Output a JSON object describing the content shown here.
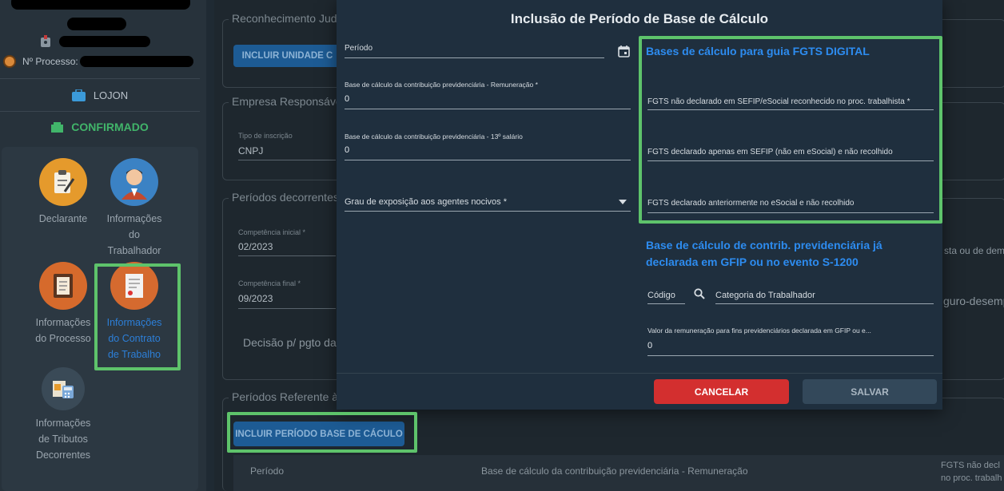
{
  "sidebar": {
    "process_label": "Nº Processo:",
    "user": "LOJON",
    "status": "CONFIRMADO",
    "menu": [
      {
        "label": "Declarante",
        "icon": "clipboard-pen-icon"
      },
      {
        "label": "Informações\ndo\nTrabalhador",
        "icon": "worker-avatar-icon"
      },
      {
        "label": "Informações\ndo Processo",
        "icon": "document-icon"
      },
      {
        "label": "Informações\ndo Contrato\nde Trabalho",
        "icon": "contract-icon"
      },
      {
        "label": "Informações\nde Tributos\nDecorrentes",
        "icon": "calculator-icon"
      }
    ]
  },
  "background": {
    "card1_title": "Reconhecimento Judi",
    "card1_button": "INCLUIR UNIDADE C",
    "card2_title": "Empresa Responsáve",
    "inscription_label": "Tipo de inscrição",
    "inscription_value": "CNPJ",
    "card3_title": "Períodos decorrentes",
    "comp_start_label": "Competência inicial *",
    "comp_start_value": "02/2023",
    "comp_end_label": "Competência final *",
    "comp_end_value": "09/2023",
    "decision_text": "Decisão p/ pgto da",
    "right_text1": "sta ou de dema",
    "right_text2": "guro-desemp",
    "card4_title": "Períodos Referente às",
    "include_period_button": "INCLUIR PERÍODO BASE DE CÁCULO",
    "table_headers": [
      "Período",
      "Base de cálculo da contribuição previdenciária - Remuneração",
      "FGTS não decl\nno proc. trabalh"
    ]
  },
  "modal": {
    "title": "Inclusão de Período de Base de Cálculo",
    "periodo_label": "Período",
    "remuneracao_label": "Base de cálculo da contribuição previdenciária - Remuneração *",
    "remuneracao_value": "0",
    "decimo_label": "Base de cálculo da contribuição previdenciária - 13º salário",
    "decimo_value": "0",
    "grau_label": "Grau de exposição aos agentes nocivos *",
    "fgts_heading": "Bases de cálculo para guia FGTS DIGITAL",
    "fgts_field1": "FGTS não declarado em SEFIP/eSocial reconhecido no proc. trabalhista *",
    "fgts_field2": "FGTS declarado apenas em SEFIP (não em eSocial) e não recolhido",
    "fgts_field3": "FGTS declarado anteriormente no eSocial e não recolhido",
    "contrib_heading": "Base de cálculo de contrib. previdenciária já\ndeclarada em GFIP ou no evento S-1200",
    "codigo_label": "Código",
    "categoria_label": "Categoria do Trabalhador",
    "valor_label": "Valor da remuneração para fins previdenciários declarada em GFIP ou e...",
    "valor_value": "0",
    "cancel_label": "CANCELAR",
    "save_label": "SALVAR"
  },
  "colors": {
    "highlight": "#5ec36b",
    "accent_blue": "#2d8cf0",
    "cancel_red": "#d32f2f",
    "confirm_green": "#41b56a"
  }
}
